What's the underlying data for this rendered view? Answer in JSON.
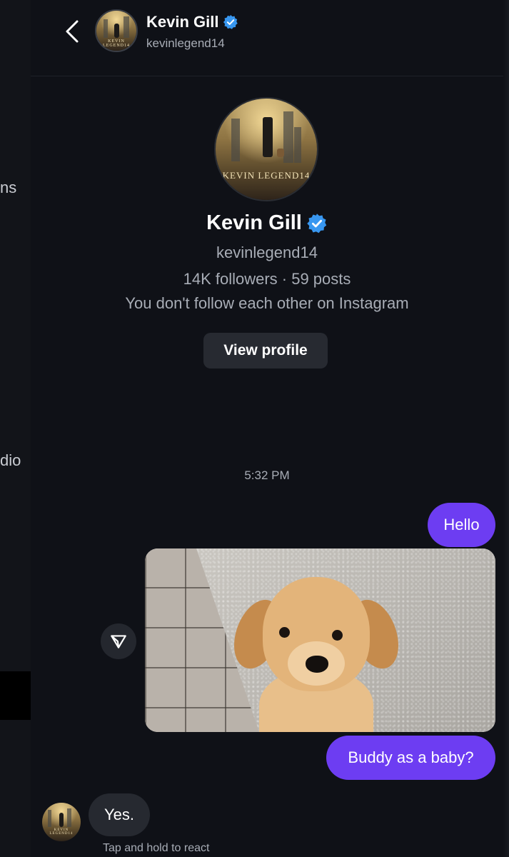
{
  "left_fragments": [
    "ns",
    "dio"
  ],
  "header": {
    "back_icon": "chevron-left-icon",
    "name": "Kevin Gill",
    "username": "kevinlegend14",
    "verified_icon": "verified-badge-icon"
  },
  "profile": {
    "poster_title": "KEVIN LEGEND14",
    "name": "Kevin Gill",
    "username": "kevinlegend14",
    "stats": "14K followers · 59 posts",
    "follow_note": "You don't follow each other on Instagram",
    "view_profile_label": "View profile"
  },
  "conversation": {
    "timestamp": "5:32 PM",
    "messages": [
      {
        "from": "me",
        "type": "text",
        "text": "Hello"
      },
      {
        "from": "me",
        "type": "image",
        "description": "golden retriever puppy"
      },
      {
        "from": "me",
        "type": "text",
        "text": "Buddy as a baby?"
      },
      {
        "from": "them",
        "type": "text",
        "text": "Yes."
      }
    ],
    "share_icon": "send-icon",
    "react_hint": "Tap and hold to react"
  },
  "colors": {
    "background": "#0f1117",
    "sent_bubble": "#6d3df2",
    "received_bubble": "#262930",
    "verified": "#3897f0",
    "secondary_text": "#a8adb6"
  }
}
